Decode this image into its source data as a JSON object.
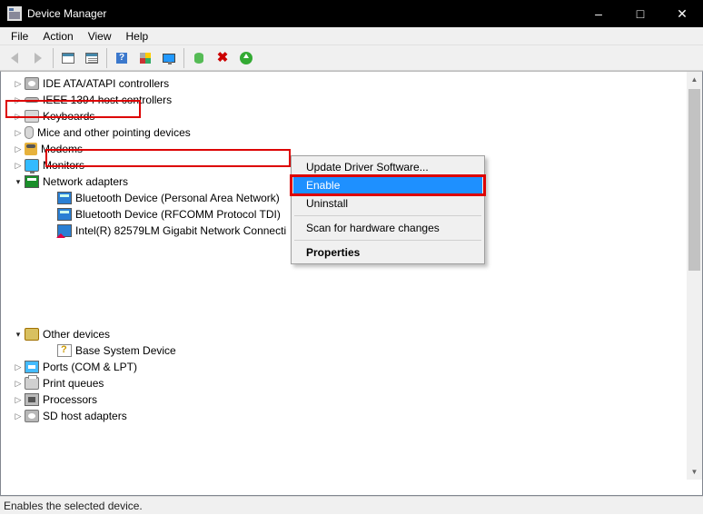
{
  "window": {
    "title": "Device Manager"
  },
  "menus": {
    "file": "File",
    "action": "Action",
    "view": "View",
    "help": "Help"
  },
  "tree": {
    "ide": "IDE ATA/ATAPI controllers",
    "ieee": "IEEE 1394 host controllers",
    "keyboards": "Keyboards",
    "mice": "Mice and other pointing devices",
    "modems": "Modems",
    "monitors": "Monitors",
    "network": "Network adapters",
    "bt_pa": "Bluetooth Device (Personal Area Network)",
    "bt_rf": "Bluetooth Device (RFCOMM Protocol TDI)",
    "intel": "Intel(R) 82579LM Gigabit Network Connecti",
    "other": "Other devices",
    "base": "Base System Device",
    "ports": "Ports (COM & LPT)",
    "print": "Print queues",
    "proc": "Processors",
    "sd": "SD host adapters"
  },
  "context": {
    "update": "Update Driver Software...",
    "enable": "Enable",
    "uninstall": "Uninstall",
    "scan": "Scan for hardware changes",
    "properties": "Properties"
  },
  "status": "Enables the selected device."
}
